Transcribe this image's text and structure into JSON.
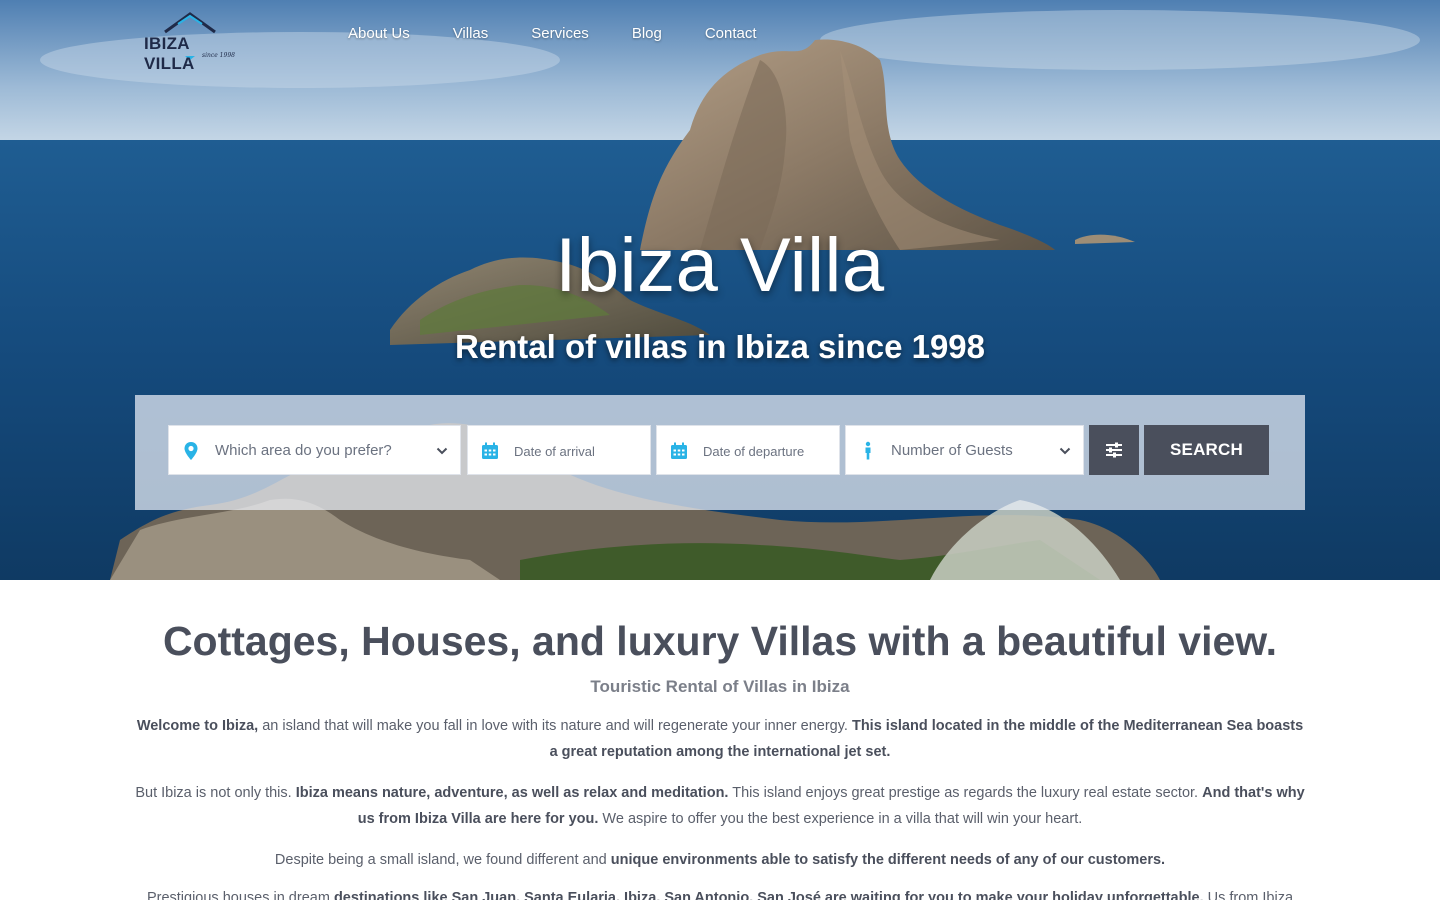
{
  "brand": {
    "name": "IBIZA VILLA",
    "since": "since 1998"
  },
  "nav": {
    "items": [
      {
        "label": "About Us"
      },
      {
        "label": "Villas"
      },
      {
        "label": "Services"
      },
      {
        "label": "Blog"
      },
      {
        "label": "Contact"
      }
    ]
  },
  "hero": {
    "title": "Ibiza Villa",
    "subtitle": "Rental of villas in Ibiza since 1998"
  },
  "search": {
    "area_placeholder": "Which area do you prefer?",
    "arrival_placeholder": "Date of arrival",
    "departure_placeholder": "Date of departure",
    "guests_placeholder": "Number of Guests",
    "button_label": "SEARCH"
  },
  "colors": {
    "accent": "#29b3e6",
    "button": "#4a4f5c",
    "text": "#4a4f5c"
  },
  "content": {
    "headline": "Cottages, Houses, and luxury Villas with a beautiful view.",
    "tagline": "Touristic Rental of Villas in Ibiza",
    "p1": {
      "a": "Welcome to Ibiza,",
      "b": " an island that will make you fall in love with its nature and will regenerate your inner energy. ",
      "c": "This island located in the middle of the Mediterranean Sea boasts a great reputation among the international jet set."
    },
    "p2": {
      "a": "But Ibiza is not only this. ",
      "b": "Ibiza means nature, adventure, as well as relax and meditation.",
      "c": " This island enjoys great prestige as regards the luxury real estate sector. ",
      "d": "And that's why us from Ibiza Villa are here for you.",
      "e": " We aspire to offer you the best experience in a villa that will win your heart."
    },
    "p3": {
      "a": "Despite being a small island, we found different and ",
      "b": "unique environments able to satisfy the different needs of any of our customers."
    },
    "p4": {
      "a": "Prestigious houses in dream ",
      "b": "destinations like San Juan, Santa Eularia, Ibiza, San Antonio, San José are waiting for you to make your holiday unforgettable.",
      "c": " Us from Ibiza Villa offer"
    }
  }
}
